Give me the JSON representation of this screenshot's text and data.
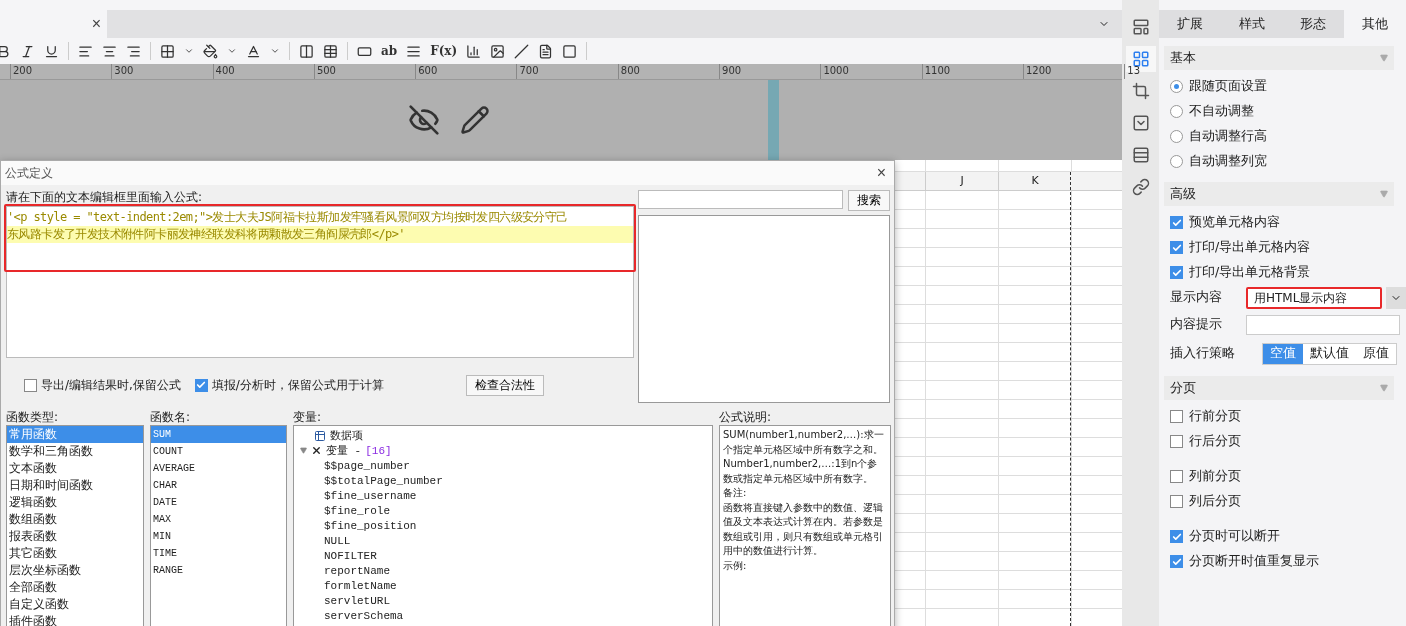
{
  "document_tabs": [
    {
      "close": "×",
      "selected": true
    }
  ],
  "toolbar": {
    "text_buttons": [
      "ab",
      "F(x)"
    ]
  },
  "ruler": [
    "200",
    "300",
    "400",
    "500",
    "600",
    "700",
    "800",
    "900",
    "1000",
    "1100",
    "1200",
    "13"
  ],
  "sheet": {
    "columns": [
      "J",
      "K"
    ]
  },
  "dialog": {
    "title": "公式定义",
    "close": "×",
    "prompt": "请在下面的文本编辑框里面输入公式:",
    "editor_lines": [
      {
        "text": "'<p style = \"text-indent:2em;\">发士大夫JS阿福卡拉斯加发牢骚看风景阿双方均按时发四六级安分守己",
        "current": false
      },
      {
        "text": "东风路卡发了开发技术附件阿卡丽发神经联发科将两颗散发三角阎屎壳郎</p>'",
        "current": true
      }
    ],
    "search_button": "搜索",
    "options": [
      {
        "label": "导出/编辑结果时,保留公式",
        "checked": false
      },
      {
        "label": "填报/分析时，保留公式用于计算",
        "checked": true
      }
    ],
    "check_button": "检查合法性",
    "function_types": {
      "label": "函数类型:",
      "items": [
        {
          "text": "常用函数",
          "selected": true
        },
        {
          "text": "数学和三角函数",
          "selected": false
        },
        {
          "text": "文本函数",
          "selected": false
        },
        {
          "text": "日期和时间函数",
          "selected": false
        },
        {
          "text": "逻辑函数",
          "selected": false
        },
        {
          "text": "数组函数",
          "selected": false
        },
        {
          "text": "报表函数",
          "selected": false
        },
        {
          "text": "其它函数",
          "selected": false
        },
        {
          "text": "层次坐标函数",
          "selected": false
        },
        {
          "text": "全部函数",
          "selected": false
        },
        {
          "text": "自定义函数",
          "selected": false
        },
        {
          "text": "插件函数",
          "selected": false
        }
      ]
    },
    "function_names": {
      "label": "函数名:",
      "items": [
        {
          "text": "SUM",
          "selected": true
        },
        {
          "text": "COUNT",
          "selected": false
        },
        {
          "text": "AVERAGE",
          "selected": false
        },
        {
          "text": "CHAR",
          "selected": false
        },
        {
          "text": "DATE",
          "selected": false
        },
        {
          "text": "MAX",
          "selected": false
        },
        {
          "text": "MIN",
          "selected": false
        },
        {
          "text": "TIME",
          "selected": false
        },
        {
          "text": "RANGE",
          "selected": false
        }
      ]
    },
    "variables": {
      "label": "变量:",
      "tree": [
        {
          "kind": "dataset",
          "label": "数据项"
        },
        {
          "kind": "group",
          "label": "变量 - ",
          "count": "[16]",
          "expanded": true,
          "children": [
            {
              "label": "$$page_number"
            },
            {
              "label": "$$totalPage_number"
            },
            {
              "label": "$fine_username"
            },
            {
              "label": "$fine_role"
            },
            {
              "label": "$fine_position"
            },
            {
              "label": "NULL"
            },
            {
              "label": "NOFILTER"
            },
            {
              "label": "reportName"
            },
            {
              "label": "formletName"
            },
            {
              "label": "servletURL"
            },
            {
              "label": "serverSchema"
            }
          ]
        }
      ]
    },
    "description": {
      "label": "公式说明:",
      "paragraphs": [
        "SUM(number1,number2,…):求一个指定单元格区域中所有数字之和。",
        "Number1,number2,…:1到n个参数或指定单元格区域中所有数字。",
        "备注:",
        "函数将直接键入参数中的数值、逻辑值及文本表达式计算在内。若参数是数组或引用，则只有数组或单元格引用中的数值进行计算。",
        "示例:"
      ]
    }
  },
  "side_icons": [
    {
      "kind": "layout",
      "selected": false
    },
    {
      "kind": "cellinfo",
      "selected": true
    },
    {
      "kind": "crop",
      "selected": false
    },
    {
      "kind": "dropdown",
      "selected": false
    },
    {
      "kind": "rows",
      "selected": false
    },
    {
      "kind": "link",
      "selected": false
    }
  ],
  "panel": {
    "tabs": [
      {
        "label": "扩展",
        "selected": false
      },
      {
        "label": "样式",
        "selected": false
      },
      {
        "label": "形态",
        "selected": false
      },
      {
        "label": "其他",
        "selected": true
      }
    ],
    "sections": [
      {
        "title": "基本",
        "items": [
          {
            "kind": "radio",
            "label": "跟随页面设置",
            "selected": true
          },
          {
            "kind": "radio",
            "label": "不自动调整",
            "selected": false
          },
          {
            "kind": "radio",
            "label": "自动调整行高",
            "selected": false
          },
          {
            "kind": "radio",
            "label": "自动调整列宽",
            "selected": false
          }
        ]
      },
      {
        "title": "高级",
        "items": [
          {
            "kind": "checkbox",
            "label": "预览单元格内容",
            "checked": true
          },
          {
            "kind": "checkbox",
            "label": "打印/导出单元格内容",
            "checked": true
          },
          {
            "kind": "checkbox",
            "label": "打印/导出单元格背景",
            "checked": true
          },
          {
            "kind": "select",
            "label": "显示内容",
            "value": "用HTML显示内容"
          },
          {
            "kind": "input",
            "label": "内容提示"
          },
          {
            "kind": "segmented",
            "label": "插入行策略",
            "options": [
              {
                "text": "空值",
                "selected": true
              },
              {
                "text": "默认值",
                "selected": false
              },
              {
                "text": "原值",
                "selected": false
              }
            ]
          }
        ]
      },
      {
        "title": "分页",
        "items": [
          {
            "kind": "checkbox",
            "label": "行前分页",
            "checked": false
          },
          {
            "kind": "checkbox",
            "label": "行后分页",
            "checked": false
          },
          {
            "kind": "spacer"
          },
          {
            "kind": "checkbox",
            "label": "列前分页",
            "checked": false
          },
          {
            "kind": "checkbox",
            "label": "列后分页",
            "checked": false
          },
          {
            "kind": "spacer"
          },
          {
            "kind": "checkbox",
            "label": "分页时可以断开",
            "checked": true
          },
          {
            "kind": "checkbox",
            "label": "分页断开时值重复显示",
            "checked": true
          }
        ]
      }
    ]
  }
}
